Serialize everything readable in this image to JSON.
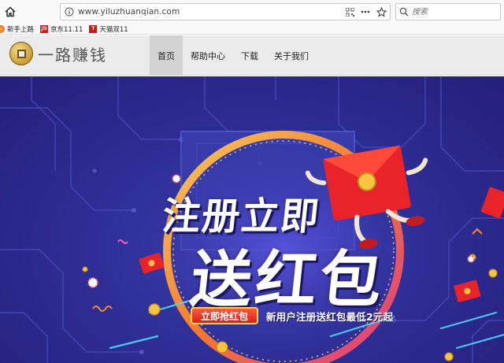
{
  "browser": {
    "url": "www.yiluzhuanqian.com",
    "search_placeholder": "搜索",
    "bookmarks": [
      {
        "label": "新手上路",
        "icon": "firefox-icon"
      },
      {
        "label": "京东11.11",
        "icon": "jd-icon"
      },
      {
        "label": "天猫双11",
        "icon": "tmall-icon"
      }
    ]
  },
  "site": {
    "logo_text": "一路赚钱",
    "nav": [
      {
        "label": "首页",
        "active": true
      },
      {
        "label": "帮助中心",
        "active": false
      },
      {
        "label": "下载",
        "active": false
      },
      {
        "label": "关于我们",
        "active": false
      }
    ]
  },
  "banner": {
    "headline_1": "注册立即",
    "headline_2": "送红包",
    "cta_label": "立即抢红包",
    "subline": "新用户注册送红包最低2元起"
  },
  "colors": {
    "banner_bg": "#2e2e96",
    "ring": "#ff8a2a",
    "envelope": "#e8232a",
    "cta": "#d8201d",
    "gold": "#f5c542"
  }
}
